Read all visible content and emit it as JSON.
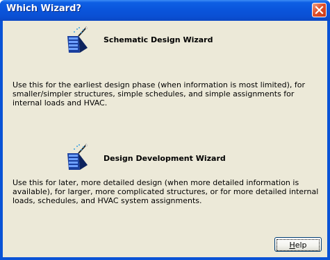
{
  "window": {
    "title": "Which Wizard?",
    "close_icon": "close-icon"
  },
  "wizards": [
    {
      "icon": "wizard-wand-icon",
      "title": "Schematic Design Wizard",
      "description": "Use this for the earliest design phase (when information is most limited), for smaller/simpler structures, simple schedules, and simple assignments for internal loads and HVAC."
    },
    {
      "icon": "wizard-wand-icon",
      "title": "Design Development Wizard",
      "description": "Use this for later, more detailed design (when more detailed information is available), for larger, more complicated structures, or for more detailed internal loads, schedules, and HVAC system assignments."
    }
  ],
  "buttons": {
    "help_mnemonic": "H",
    "help_rest": "elp"
  },
  "colors": {
    "titlebar": "#0a55dc",
    "client": "#ece9d8",
    "close": "#e0502a"
  }
}
